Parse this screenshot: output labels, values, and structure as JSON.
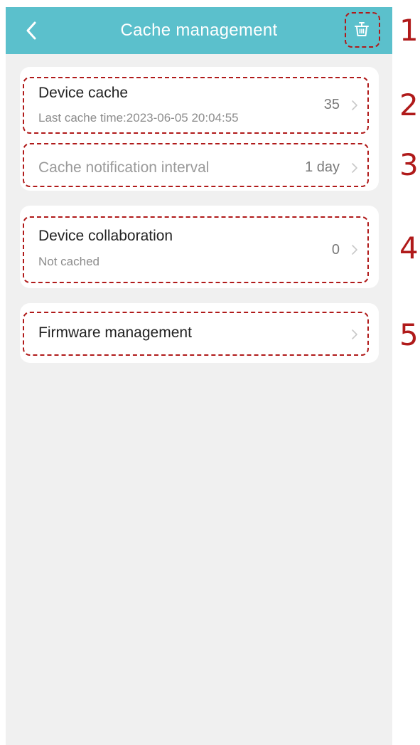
{
  "header": {
    "title": "Cache management",
    "background_color": "#5bc0cc",
    "back_icon": "chevron-left-icon",
    "clear_icon": "trash-basket-icon"
  },
  "device_cache": {
    "title": "Device cache",
    "subtitle": "Last cache time:2023-06-05 20:04:55",
    "value": "35"
  },
  "cache_notification": {
    "title": "Cache notification interval",
    "value": "1 day"
  },
  "device_collaboration": {
    "title": "Device collaboration",
    "subtitle": "Not cached",
    "value": "0"
  },
  "firmware": {
    "title": "Firmware management"
  },
  "annotations": {
    "color": "#b01a1a",
    "labels": [
      "1",
      "2",
      "3",
      "4",
      "5"
    ]
  }
}
